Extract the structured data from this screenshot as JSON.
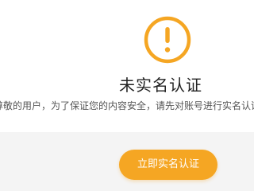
{
  "notice": {
    "title": "未实名认证",
    "description": "尊敬的用户，为了保证您的内容安全，请先对账号进行实名认证",
    "button_label": "立即实名认证"
  },
  "colors": {
    "accent": "#f5a623",
    "title_text": "#222222",
    "desc_text": "#555555",
    "band": "#f4f4f4"
  },
  "icons": {
    "alert": "exclamation-circle-icon"
  }
}
